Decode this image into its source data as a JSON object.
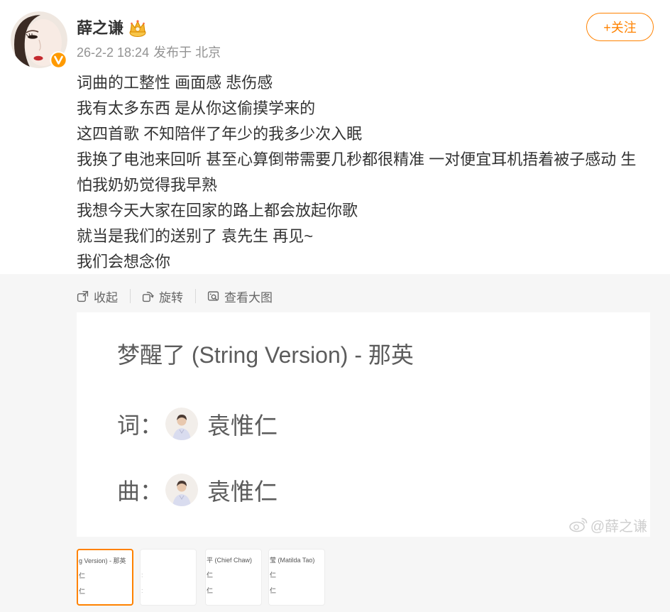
{
  "colors": {
    "accent": "#ff8200",
    "text": "#333333",
    "meta": "#939393",
    "toolbar": "#666666",
    "page_bg": "#f6f6f6"
  },
  "post": {
    "author": {
      "name": "薛之谦",
      "avatar_icon": "avatar",
      "verified_icon": "verified-v-icon",
      "badge_icon": "crown-badge-icon"
    },
    "meta": {
      "time": "26-2-2 18:24",
      "location": "发布于 北京"
    },
    "follow_button": {
      "label": "+关注"
    },
    "text_lines": [
      "词曲的工整性 画面感 悲伤感",
      "我有太多东西 是从你这偷摸学来的",
      "这四首歌 不知陪伴了年少的我多少次入眠",
      "我换了电池来回听 甚至心算倒带需要几秒都很精准 一对便宜耳机捂着被子感动 生",
      "怕我奶奶觉得我早熟",
      "我想今天大家在回家的路上都会放起你歌",
      "就当是我们的送别了 袁先生 再见~",
      "我们会想念你"
    ]
  },
  "media_toolbar": {
    "collapse": {
      "label": "收起",
      "icon": "collapse-icon"
    },
    "rotate": {
      "label": "旋转",
      "icon": "rotate-icon"
    },
    "view_large": {
      "label": "查看大图",
      "icon": "view-large-icon"
    }
  },
  "image": {
    "title": "梦醒了 (String Version) - 那英",
    "credits": [
      {
        "label": "词：",
        "name": "袁惟仁"
      },
      {
        "label": "曲：",
        "name": "袁惟仁"
      }
    ],
    "watermark": {
      "icon": "weibo-logo-icon",
      "text": "@薛之谦"
    }
  },
  "thumbnails": [
    {
      "lines": [
        "g Version) - 那英",
        "仁",
        "仁"
      ],
      "selected": true
    },
    {
      "lines": [
        "",
        ":",
        ":"
      ],
      "selected": false
    },
    {
      "lines": [
        "平 (Chief Chaw)",
        "仁",
        "仁"
      ],
      "selected": false
    },
    {
      "lines": [
        "莹 (Matilda Tao)",
        "仁",
        "仁"
      ],
      "selected": false
    }
  ]
}
